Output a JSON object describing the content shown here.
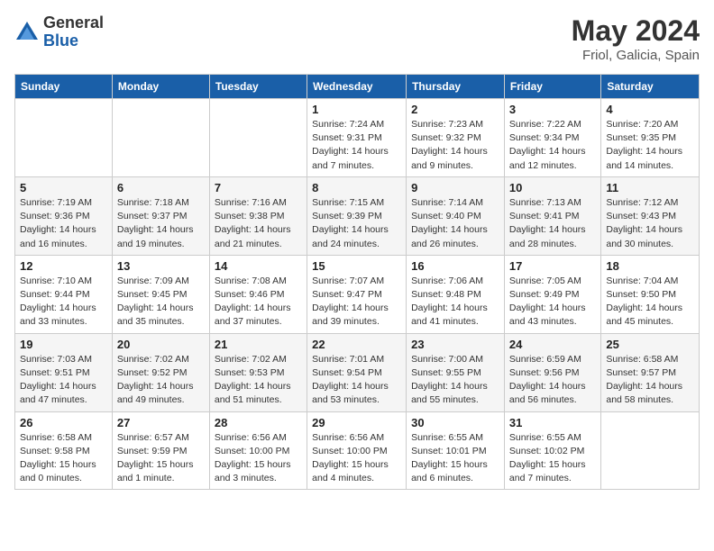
{
  "header": {
    "logo_general": "General",
    "logo_blue": "Blue",
    "month_year": "May 2024",
    "location": "Friol, Galicia, Spain"
  },
  "weekdays": [
    "Sunday",
    "Monday",
    "Tuesday",
    "Wednesday",
    "Thursday",
    "Friday",
    "Saturday"
  ],
  "weeks": [
    [
      {
        "day": "",
        "info": ""
      },
      {
        "day": "",
        "info": ""
      },
      {
        "day": "",
        "info": ""
      },
      {
        "day": "1",
        "info": "Sunrise: 7:24 AM\nSunset: 9:31 PM\nDaylight: 14 hours\nand 7 minutes."
      },
      {
        "day": "2",
        "info": "Sunrise: 7:23 AM\nSunset: 9:32 PM\nDaylight: 14 hours\nand 9 minutes."
      },
      {
        "day": "3",
        "info": "Sunrise: 7:22 AM\nSunset: 9:34 PM\nDaylight: 14 hours\nand 12 minutes."
      },
      {
        "day": "4",
        "info": "Sunrise: 7:20 AM\nSunset: 9:35 PM\nDaylight: 14 hours\nand 14 minutes."
      }
    ],
    [
      {
        "day": "5",
        "info": "Sunrise: 7:19 AM\nSunset: 9:36 PM\nDaylight: 14 hours\nand 16 minutes."
      },
      {
        "day": "6",
        "info": "Sunrise: 7:18 AM\nSunset: 9:37 PM\nDaylight: 14 hours\nand 19 minutes."
      },
      {
        "day": "7",
        "info": "Sunrise: 7:16 AM\nSunset: 9:38 PM\nDaylight: 14 hours\nand 21 minutes."
      },
      {
        "day": "8",
        "info": "Sunrise: 7:15 AM\nSunset: 9:39 PM\nDaylight: 14 hours\nand 24 minutes."
      },
      {
        "day": "9",
        "info": "Sunrise: 7:14 AM\nSunset: 9:40 PM\nDaylight: 14 hours\nand 26 minutes."
      },
      {
        "day": "10",
        "info": "Sunrise: 7:13 AM\nSunset: 9:41 PM\nDaylight: 14 hours\nand 28 minutes."
      },
      {
        "day": "11",
        "info": "Sunrise: 7:12 AM\nSunset: 9:43 PM\nDaylight: 14 hours\nand 30 minutes."
      }
    ],
    [
      {
        "day": "12",
        "info": "Sunrise: 7:10 AM\nSunset: 9:44 PM\nDaylight: 14 hours\nand 33 minutes."
      },
      {
        "day": "13",
        "info": "Sunrise: 7:09 AM\nSunset: 9:45 PM\nDaylight: 14 hours\nand 35 minutes."
      },
      {
        "day": "14",
        "info": "Sunrise: 7:08 AM\nSunset: 9:46 PM\nDaylight: 14 hours\nand 37 minutes."
      },
      {
        "day": "15",
        "info": "Sunrise: 7:07 AM\nSunset: 9:47 PM\nDaylight: 14 hours\nand 39 minutes."
      },
      {
        "day": "16",
        "info": "Sunrise: 7:06 AM\nSunset: 9:48 PM\nDaylight: 14 hours\nand 41 minutes."
      },
      {
        "day": "17",
        "info": "Sunrise: 7:05 AM\nSunset: 9:49 PM\nDaylight: 14 hours\nand 43 minutes."
      },
      {
        "day": "18",
        "info": "Sunrise: 7:04 AM\nSunset: 9:50 PM\nDaylight: 14 hours\nand 45 minutes."
      }
    ],
    [
      {
        "day": "19",
        "info": "Sunrise: 7:03 AM\nSunset: 9:51 PM\nDaylight: 14 hours\nand 47 minutes."
      },
      {
        "day": "20",
        "info": "Sunrise: 7:02 AM\nSunset: 9:52 PM\nDaylight: 14 hours\nand 49 minutes."
      },
      {
        "day": "21",
        "info": "Sunrise: 7:02 AM\nSunset: 9:53 PM\nDaylight: 14 hours\nand 51 minutes."
      },
      {
        "day": "22",
        "info": "Sunrise: 7:01 AM\nSunset: 9:54 PM\nDaylight: 14 hours\nand 53 minutes."
      },
      {
        "day": "23",
        "info": "Sunrise: 7:00 AM\nSunset: 9:55 PM\nDaylight: 14 hours\nand 55 minutes."
      },
      {
        "day": "24",
        "info": "Sunrise: 6:59 AM\nSunset: 9:56 PM\nDaylight: 14 hours\nand 56 minutes."
      },
      {
        "day": "25",
        "info": "Sunrise: 6:58 AM\nSunset: 9:57 PM\nDaylight: 14 hours\nand 58 minutes."
      }
    ],
    [
      {
        "day": "26",
        "info": "Sunrise: 6:58 AM\nSunset: 9:58 PM\nDaylight: 15 hours\nand 0 minutes."
      },
      {
        "day": "27",
        "info": "Sunrise: 6:57 AM\nSunset: 9:59 PM\nDaylight: 15 hours\nand 1 minute."
      },
      {
        "day": "28",
        "info": "Sunrise: 6:56 AM\nSunset: 10:00 PM\nDaylight: 15 hours\nand 3 minutes."
      },
      {
        "day": "29",
        "info": "Sunrise: 6:56 AM\nSunset: 10:00 PM\nDaylight: 15 hours\nand 4 minutes."
      },
      {
        "day": "30",
        "info": "Sunrise: 6:55 AM\nSunset: 10:01 PM\nDaylight: 15 hours\nand 6 minutes."
      },
      {
        "day": "31",
        "info": "Sunrise: 6:55 AM\nSunset: 10:02 PM\nDaylight: 15 hours\nand 7 minutes."
      },
      {
        "day": "",
        "info": ""
      }
    ]
  ]
}
